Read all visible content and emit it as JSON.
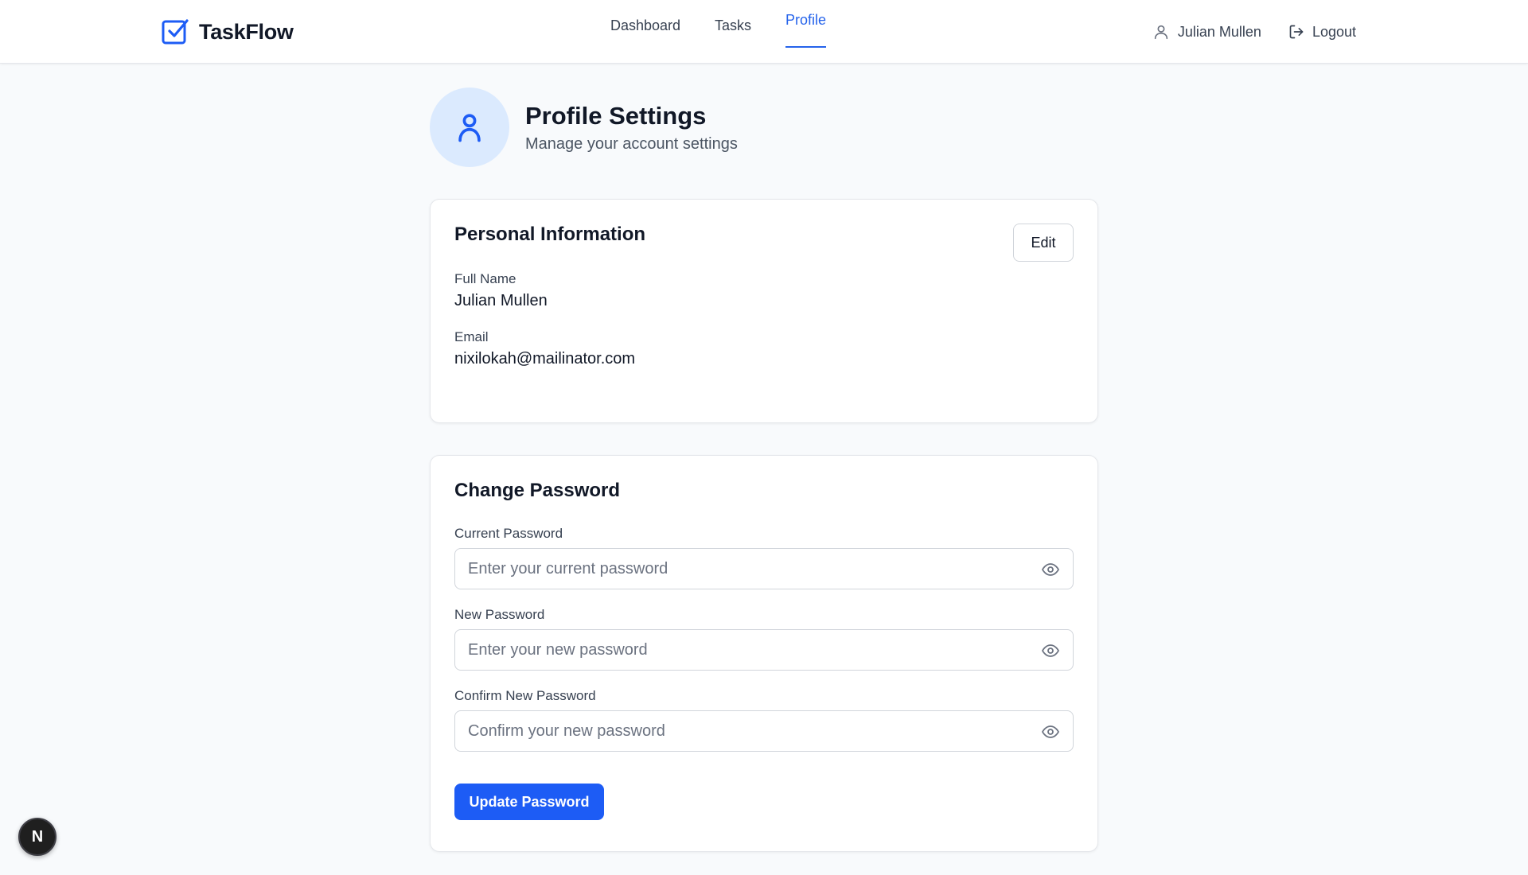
{
  "app": {
    "name": "TaskFlow",
    "logo_icon": "checkbox-icon"
  },
  "nav": {
    "items": [
      {
        "label": "Dashboard",
        "active": false
      },
      {
        "label": "Tasks",
        "active": false
      },
      {
        "label": "Profile",
        "active": true
      }
    ]
  },
  "user": {
    "name": "Julian Mullen",
    "icon": "user-icon"
  },
  "logout": {
    "label": "Logout",
    "icon": "logout-icon"
  },
  "page": {
    "title": "Profile Settings",
    "subtitle": "Manage your account settings",
    "avatar_icon": "user-icon"
  },
  "personal": {
    "title": "Personal Information",
    "edit_label": "Edit",
    "fields": [
      {
        "label": "Full Name",
        "value": "Julian Mullen"
      },
      {
        "label": "Email",
        "value": "nixilokah@mailinator.com"
      }
    ]
  },
  "password": {
    "title": "Change Password",
    "fields": [
      {
        "label": "Current Password",
        "placeholder": "Enter your current password",
        "value": ""
      },
      {
        "label": "New Password",
        "placeholder": "Enter your new password",
        "value": ""
      },
      {
        "label": "Confirm New Password",
        "placeholder": "Confirm your new password",
        "value": ""
      }
    ],
    "submit_label": "Update Password"
  },
  "dev_badge": {
    "label": "N"
  },
  "colors": {
    "accent": "#1d5cf5",
    "nav_active": "#2563eb",
    "avatar_bg": "#dbeafe",
    "background": "#f8fafc"
  }
}
